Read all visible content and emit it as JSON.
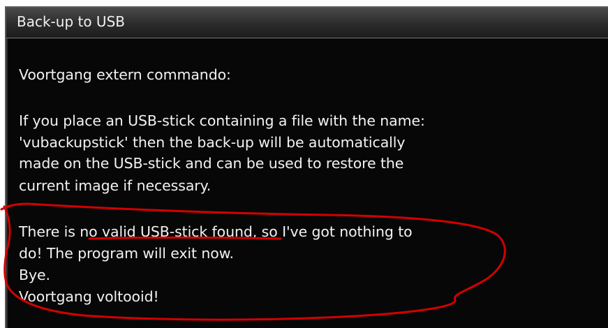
{
  "window": {
    "title": "Back-up to USB"
  },
  "content": {
    "heading": "Voortgang extern commando:",
    "info_lines": [
      "If you place an USB-stick containing a file with the name:",
      "'vubackupstick' then the back-up will be automatically",
      "made on the USB-stick and can be used to restore the",
      "current image if necessary."
    ],
    "result_lines": [
      "There is no valid USB-stick found, so I've got nothing to",
      "do! The program will exit now.",
      "Bye.",
      "Voortgang voltooid!"
    ]
  },
  "colors": {
    "background": "#070707",
    "text": "#f2f2f2",
    "annotation": "#d40000"
  }
}
